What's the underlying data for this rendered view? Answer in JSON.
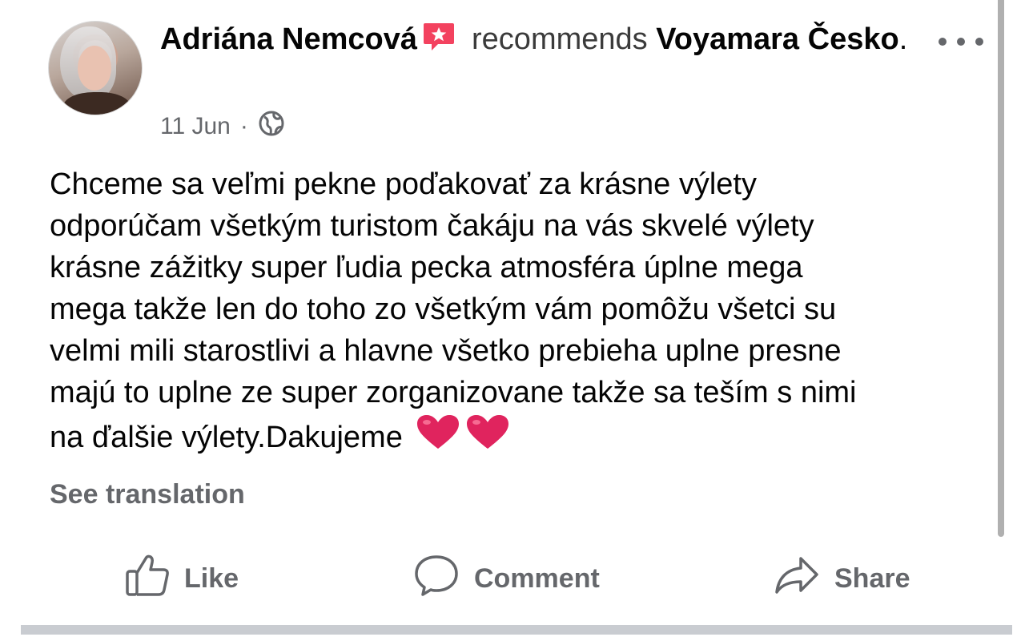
{
  "post": {
    "author": "Adriána Nemcová",
    "action": "recommends",
    "page_name": "Voyamara Česko",
    "period": ".",
    "date": "11 Jun",
    "separator": "·",
    "audience_icon": "globe-icon",
    "body": "Chceme sa veľmi pekne poďakovať za krásne výlety\nodporúčam všetkým turistom čakáju na vás skvelé výlety\nkrásne zážitky super ľudia pecka atmosféra úplne mega\nmega takže len do toho zo všetkým vám pomôžu všetci su\nvelmi mili starostlivi a hlavne všetko prebieha uplne presne\nmajú to uplne ze super zorganizovane takže sa teším s nimi\nna ďalšie výlety.Dakujeme",
    "emoji": "❤️❤️",
    "see_translation": "See translation"
  },
  "actions": {
    "like": "Like",
    "comment": "Comment",
    "share": "Share"
  },
  "colors": {
    "recommend_badge": "#f3425f",
    "secondary_text": "#65676b",
    "heart": "#e0245e"
  }
}
